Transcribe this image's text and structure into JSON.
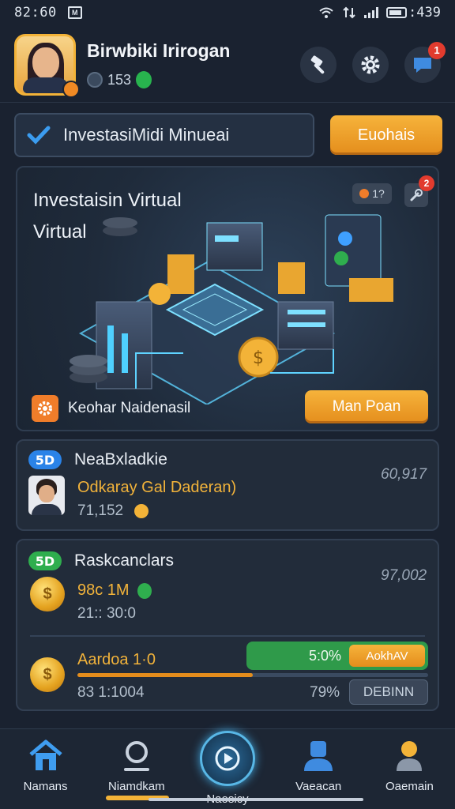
{
  "status": {
    "time": "82:60",
    "battery_time": ":439"
  },
  "header": {
    "user_name": "Birwbiki Irirogan",
    "stats_value": "153",
    "notification_count": "1"
  },
  "top": {
    "invest_label": "InvestasiMidi Minueai",
    "cta_label": "Euohais"
  },
  "hero": {
    "title": "Investaisin Virtual Virtual",
    "counter": "1?",
    "tool_badge": "2",
    "footer_label": "Keohar Naidenasil",
    "button_label": "Man Poan"
  },
  "card1": {
    "rank": "5D",
    "title": "NeaBxladkie",
    "right_value": "60,917",
    "name": "Odkaray Gal Daderan)",
    "score": "71,152"
  },
  "card2": {
    "rank": "5D",
    "title": "Raskcanclars",
    "right_value": "97,002",
    "amount": "98c 1M",
    "sub_value": "21:: 30:0",
    "row2_title": "Aardoa 1·0",
    "row2_value": "83 1:1004",
    "progress_percent_text": "5:0%",
    "progress_fraction": 0.5,
    "action_label": "AokhAV",
    "percent_2": "79%",
    "ghost_label": "DEBINN"
  },
  "nav": {
    "items": [
      {
        "label": "Namans"
      },
      {
        "label": "Niamdkam"
      },
      {
        "label": "Naosicy"
      },
      {
        "label": "Vaeacan"
      },
      {
        "label": "Oaemain"
      }
    ]
  },
  "colors": {
    "accent": "#e48d1c",
    "bg": "#1a2230",
    "card": "#222c3a",
    "success": "#2f9a4a"
  }
}
